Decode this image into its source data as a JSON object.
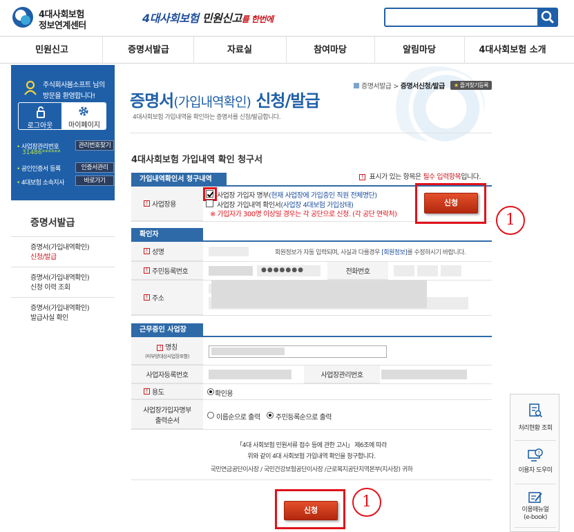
{
  "header": {
    "logo_line1": "4대사회보험",
    "logo_line2": "정보연계센터",
    "slogan_part1": "4대사회보험",
    "slogan_part2": " 민원신고",
    "slogan_part3": "를 한번에",
    "search_value": ""
  },
  "nav": {
    "items": [
      "민원신고",
      "증명서발급",
      "자료실",
      "참여마당",
      "알림마당",
      "4대사회보험 소개"
    ]
  },
  "welcome": {
    "name_line": "주식회사봄소프트 님의",
    "greeting": "방문을 환영합니다!",
    "logout_label": "로그아웃",
    "mypage_label": "마이페이지",
    "biz_no_label": "사업장관리번호",
    "biz_no_button": "관리번호찾기",
    "biz_no_value": "31486******",
    "cert_label": "공인인증서 등록",
    "cert_button": "인증서관리",
    "branch_label": "4대보험 소속지사",
    "branch_button": "바로가기"
  },
  "sidebar": {
    "title": "증명서발급",
    "items": [
      {
        "line1": "증명서(가입내역확인)",
        "line2": "신청/발급"
      },
      {
        "line1": "증명서(가입내역확인)",
        "line2": "신청 이력 조회"
      },
      {
        "line1": "증명서(가입내역확인)",
        "line2": "발급사실 확인"
      }
    ]
  },
  "page": {
    "breadcrumb_parent": "증명서발급",
    "breadcrumb_current": "증명서신청/발급",
    "favorite_button": "즐겨찾기등록",
    "title_main": "증명서",
    "title_paren": "(가입내역확인)",
    "title_end": " 신청/발급",
    "description": "4대사회보험 가입내역을 확인하는 증명서를 신청/발급합니다.",
    "form_title": "4대사회보험 가입내역 확인 청구서",
    "required_note_pre": " 표시가 있는 항목은 ",
    "required_note_red": "필수 입력항목",
    "required_note_post": "입니다."
  },
  "section1": {
    "header": "가입내역확인서 청구내역",
    "row_label": "사업장용",
    "option1_a": "사업장 가입자 명부",
    "option1_b": "(현재 사업장에 가입중인 직원 전체명단)",
    "option2_a": "사업장 가입내역 확인서",
    "option2_b": "(사업장 4대보험 가입상태)",
    "warning": "※ 가입자가 300명 이상일 경우는 각 공단으로 신청. (각 공단 연락처)",
    "apply_button": "신청",
    "callout_number": "1"
  },
  "section2": {
    "header": "확인자",
    "name_label": "성명",
    "name_note_pre": "회원정보가 자동 입력되며, 사실과 다를경우 ",
    "name_note_link": "[회원정보]",
    "name_note_post": "를 수정하시기 바랍니다.",
    "rrn_label": "주민등록번호",
    "rrn_masked": "●●●●●●●",
    "phone_label": "전화번호",
    "address_label": "주소"
  },
  "section3": {
    "header": "근무중인 사업장",
    "company_label": "명칭",
    "company_sublabel": "(미부양대상사업장포함)",
    "bizreg_label": "사업자등록번호",
    "bizmgmt_label": "사업장관리번호",
    "purpose_label": "용도",
    "purpose_option": "확인용",
    "order_label_1": "사업장가입자명부",
    "order_label_2": "출력순서",
    "order_option1": "이름순으로 출력",
    "order_option2": "주민등록순으로 출력"
  },
  "statement": {
    "line1": "「4대 사회보험 민원서류 접수 등에 관한 고시」 제6조에 따라",
    "line2": "위와 같이 4대 사회보험 가입내역 확인을 청구합니다.",
    "line3": "국민연금공단이사장 / 국민건강보험공단이사장 /근로복지공단지역본부(지사장) 귀하"
  },
  "bottom": {
    "apply_button": "신청",
    "callout_number": "1"
  },
  "quick_menu": {
    "items": [
      {
        "label": "처리현황 조회"
      },
      {
        "label": "이용자 도우미"
      },
      {
        "label_1": "이용매뉴얼",
        "label_2": "(e-book)"
      }
    ]
  },
  "colors": {
    "brand_blue": "#1f5fa8",
    "section_blue": "#2e6aa8",
    "accent_red": "#e0111a",
    "button_red": "#c8401d"
  }
}
